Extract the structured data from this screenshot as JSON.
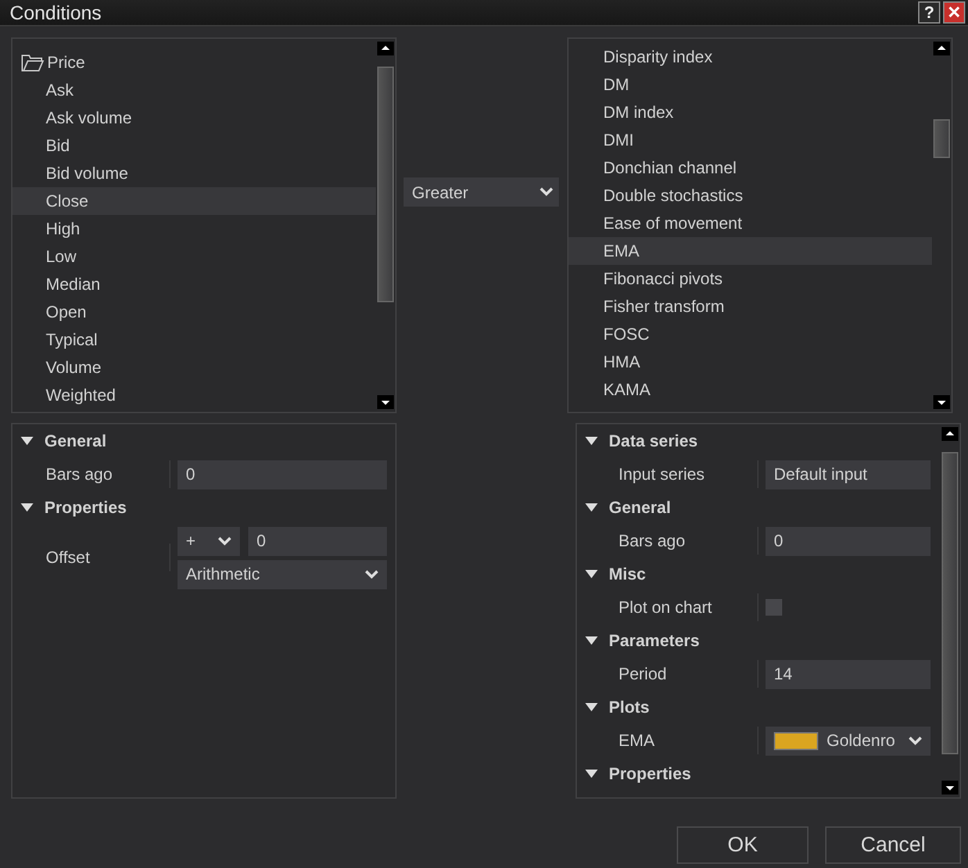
{
  "window": {
    "title": "Conditions",
    "buttons": [
      {
        "kind": "help",
        "label": "?"
      },
      {
        "kind": "close",
        "label": "✕"
      }
    ]
  },
  "left_list": {
    "folder": "Price",
    "items": [
      {
        "label": "Ask",
        "selected": false
      },
      {
        "label": "Ask volume",
        "selected": false
      },
      {
        "label": "Bid",
        "selected": false
      },
      {
        "label": "Bid volume",
        "selected": false
      },
      {
        "label": "Close",
        "selected": true
      },
      {
        "label": "High",
        "selected": false
      },
      {
        "label": "Low",
        "selected": false
      },
      {
        "label": "Median",
        "selected": false
      },
      {
        "label": "Open",
        "selected": false
      },
      {
        "label": "Typical",
        "selected": false
      },
      {
        "label": "Volume",
        "selected": false
      },
      {
        "label": "Weighted",
        "selected": false
      }
    ]
  },
  "operator": {
    "value": "Greater"
  },
  "right_list": {
    "items": [
      {
        "label": "Disparity index",
        "selected": false
      },
      {
        "label": "DM",
        "selected": false
      },
      {
        "label": "DM index",
        "selected": false
      },
      {
        "label": "DMI",
        "selected": false
      },
      {
        "label": "Donchian channel",
        "selected": false
      },
      {
        "label": "Double stochastics",
        "selected": false
      },
      {
        "label": "Ease of movement",
        "selected": false
      },
      {
        "label": "EMA",
        "selected": true
      },
      {
        "label": "Fibonacci pivots",
        "selected": false
      },
      {
        "label": "Fisher transform",
        "selected": false
      },
      {
        "label": "FOSC",
        "selected": false
      },
      {
        "label": "HMA",
        "selected": false
      },
      {
        "label": "KAMA",
        "selected": false
      }
    ]
  },
  "left_properties": [
    {
      "category": "General",
      "expanded": true,
      "rows": [
        {
          "kind": "text",
          "name": "Bars ago",
          "value": "0"
        }
      ]
    },
    {
      "category": "Properties",
      "expanded": true,
      "rows": [
        {
          "kind": "offset",
          "name": "Offset",
          "sign": "+",
          "value": "0",
          "mode": "Arithmetic"
        }
      ]
    }
  ],
  "right_properties": [
    {
      "category": "Data series",
      "expanded": true,
      "rows": [
        {
          "kind": "text",
          "name": "Input series",
          "value": "Default input"
        }
      ]
    },
    {
      "category": "General",
      "expanded": true,
      "rows": [
        {
          "kind": "text",
          "name": "Bars ago",
          "value": "0"
        }
      ]
    },
    {
      "category": "Misc",
      "expanded": true,
      "rows": [
        {
          "kind": "checkbox",
          "name": "Plot on chart",
          "checked": false
        }
      ]
    },
    {
      "category": "Parameters",
      "expanded": true,
      "rows": [
        {
          "kind": "text",
          "name": "Period",
          "value": "14"
        }
      ]
    },
    {
      "category": "Plots",
      "expanded": true,
      "rows": [
        {
          "kind": "color",
          "name": "EMA",
          "value": "Goldenro",
          "color": "#daa520"
        }
      ]
    },
    {
      "category": "Properties",
      "expanded": true
    }
  ],
  "buttons": [
    {
      "label": "OK"
    },
    {
      "label": "Cancel"
    }
  ]
}
